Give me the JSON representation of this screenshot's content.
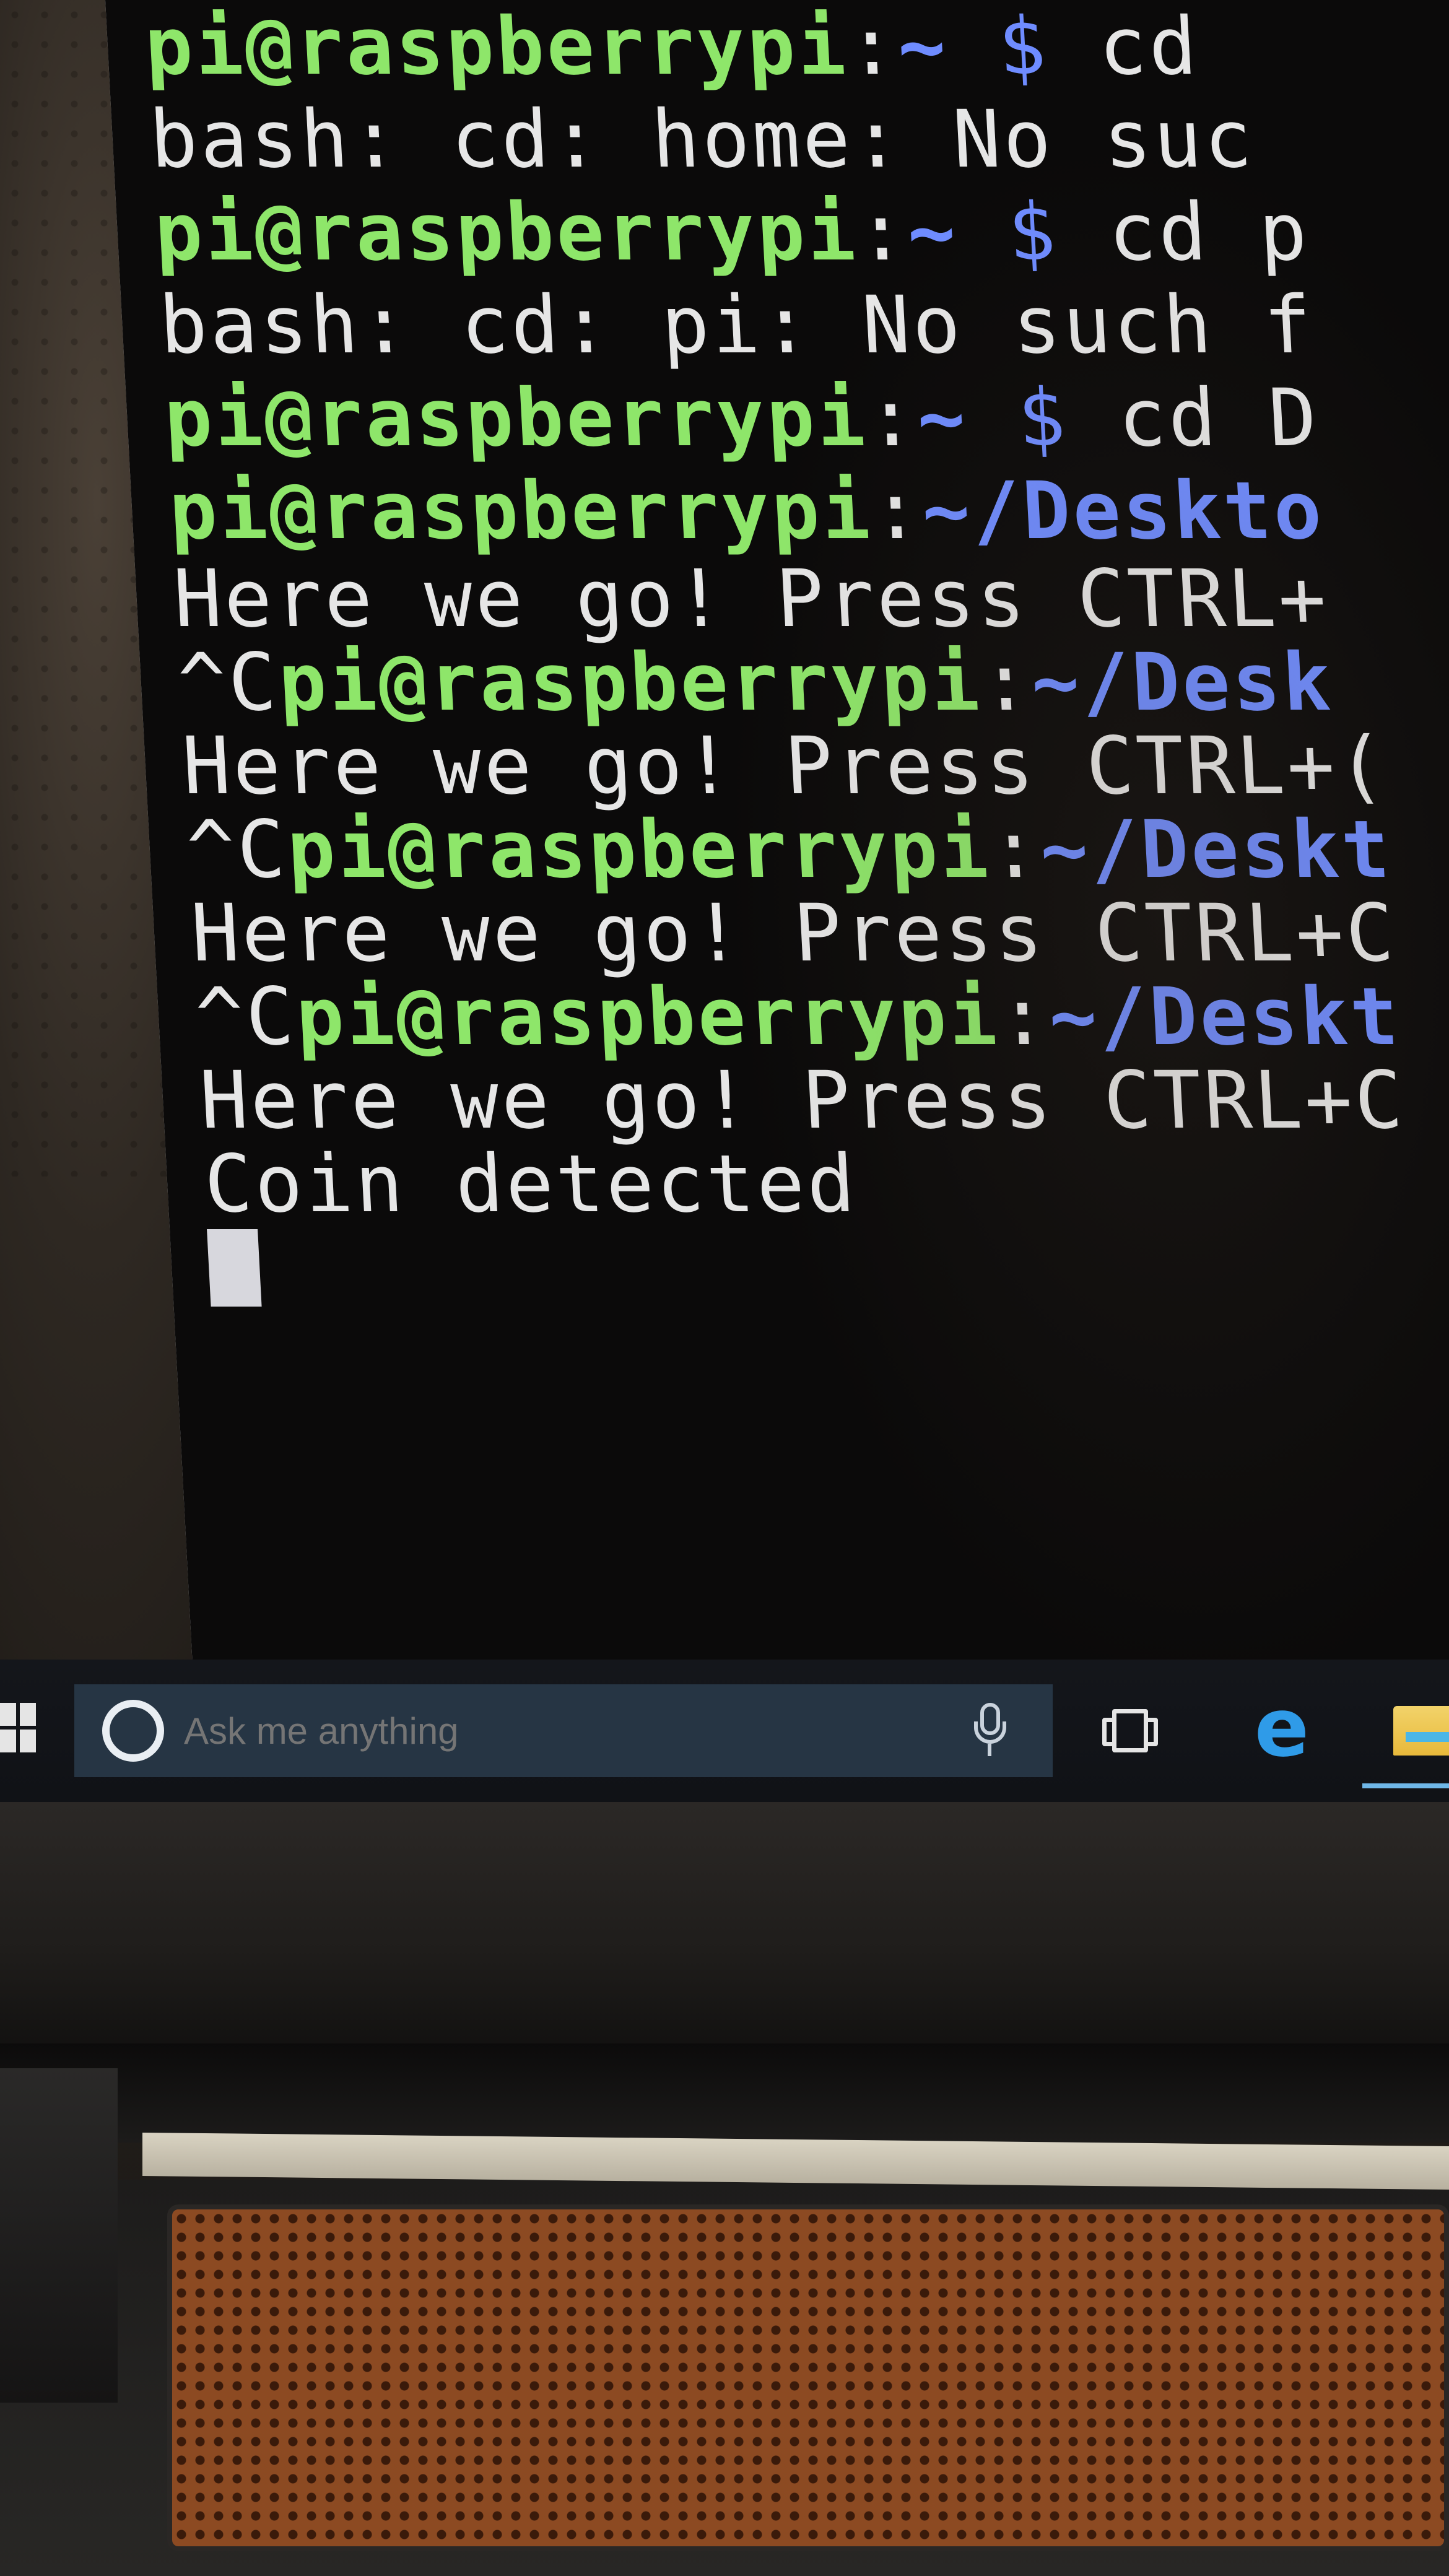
{
  "terminal": {
    "lines": [
      {
        "user": "pi@raspberrypi",
        "sep": ":",
        "path": "~",
        "prompt": " $ ",
        "cmd": "cd"
      },
      {
        "text": "bash: cd: home: No suc"
      },
      {
        "user": "pi@raspberrypi",
        "sep": ":",
        "path": "~",
        "prompt": " $ ",
        "cmd": "cd p"
      },
      {
        "text": "bash: cd: pi: No such f"
      },
      {
        "user": "pi@raspberrypi",
        "sep": ":",
        "path": "~",
        "prompt": " $ ",
        "cmd": "cd D"
      },
      {
        "user": "pi@raspberrypi",
        "sep": ":",
        "path": "~/Deskto"
      },
      {
        "text": "Here we go! Press CTRL+"
      },
      {
        "prefix": "^C",
        "user": "pi@raspberrypi",
        "sep": ":",
        "path": "~/Desk"
      },
      {
        "text": "Here we go! Press CTRL+("
      },
      {
        "prefix": "^C",
        "user": "pi@raspberrypi",
        "sep": ":",
        "path": "~/Deskt"
      },
      {
        "text": "Here we go! Press CTRL+C"
      },
      {
        "prefix": "^C",
        "user": "pi@raspberrypi",
        "sep": ":",
        "path": "~/Deskt"
      },
      {
        "text": "Here we go! Press CTRL+C"
      },
      {
        "text": "Coin detected"
      }
    ]
  },
  "taskbar": {
    "search_placeholder": "Ask me anything",
    "start_icon": "windows-logo-icon",
    "cortana_icon": "cortana-circle-icon",
    "mic_icon": "microphone-icon",
    "taskview_icon": "task-view-icon",
    "edge_icon_glyph": "e",
    "explorer_icon": "file-explorer-icon"
  },
  "colors": {
    "terminal_bg": "#0b0a0a",
    "user_green": "#8ee66a",
    "path_blue": "#6f8cff",
    "text_white": "#e6e6e6",
    "taskbar_bg": "#14161b",
    "search_bg": "#263544",
    "edge_blue": "#2f9be8"
  }
}
